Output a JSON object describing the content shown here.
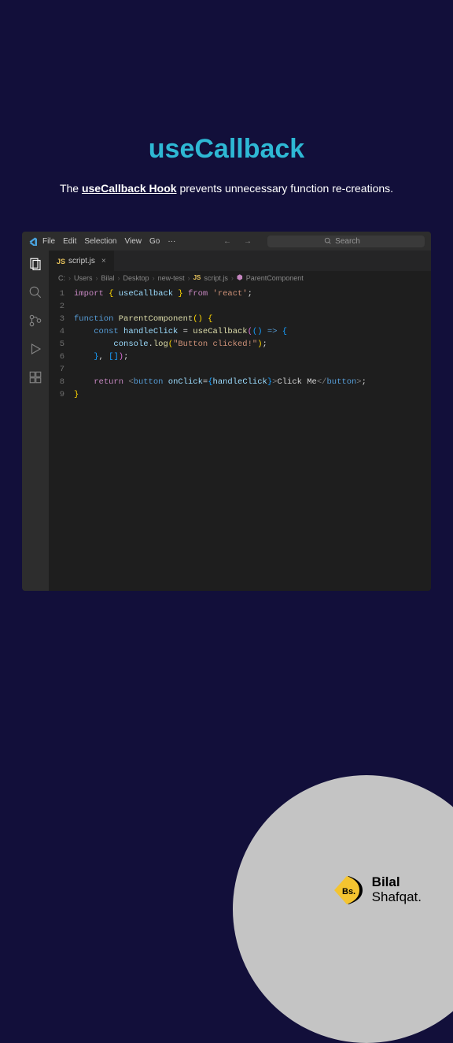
{
  "title": "useCallback",
  "subtitle_prefix": "The ",
  "subtitle_highlight": "useCallback Hook",
  "subtitle_suffix": " prevents unnecessary function re-creations.",
  "menu": {
    "file": "File",
    "edit": "Edit",
    "selection": "Selection",
    "view": "View",
    "go": "Go",
    "more": "···"
  },
  "nav": {
    "back": "←",
    "forward": "→"
  },
  "search_placeholder": "Search",
  "tab": {
    "filename": "script.js",
    "badge": "JS",
    "close": "×"
  },
  "breadcrumb": {
    "parts": [
      "C:",
      "Users",
      "Bilal",
      "Desktop",
      "new-test",
      "script.js",
      "ParentComponent"
    ],
    "sep": "›",
    "js_badge": "JS",
    "sym": "⬢"
  },
  "gutter": {
    "l1": "1",
    "l2": "2",
    "l3": "3",
    "l4": "4",
    "l5": "5",
    "l6": "6",
    "l7": "7",
    "l8": "8",
    "l9": "9"
  },
  "code": {
    "import_kw": "import",
    "from_kw": "from",
    "usecallback": "useCallback",
    "react_str": "'react'",
    "function_kw": "function",
    "component_name": "ParentComponent",
    "const_kw": "const",
    "handle_click": "handleClick",
    "arrow": "=>",
    "console": "console",
    "log": "log",
    "msg_str": "\"Button clicked!\"",
    "return_kw": "return",
    "button_tag": "button",
    "onclick_attr": "onClick",
    "click_me": "Click Me"
  },
  "footer": {
    "name": "Bilal",
    "surname": "Shafqat.",
    "badge": "Bs."
  }
}
